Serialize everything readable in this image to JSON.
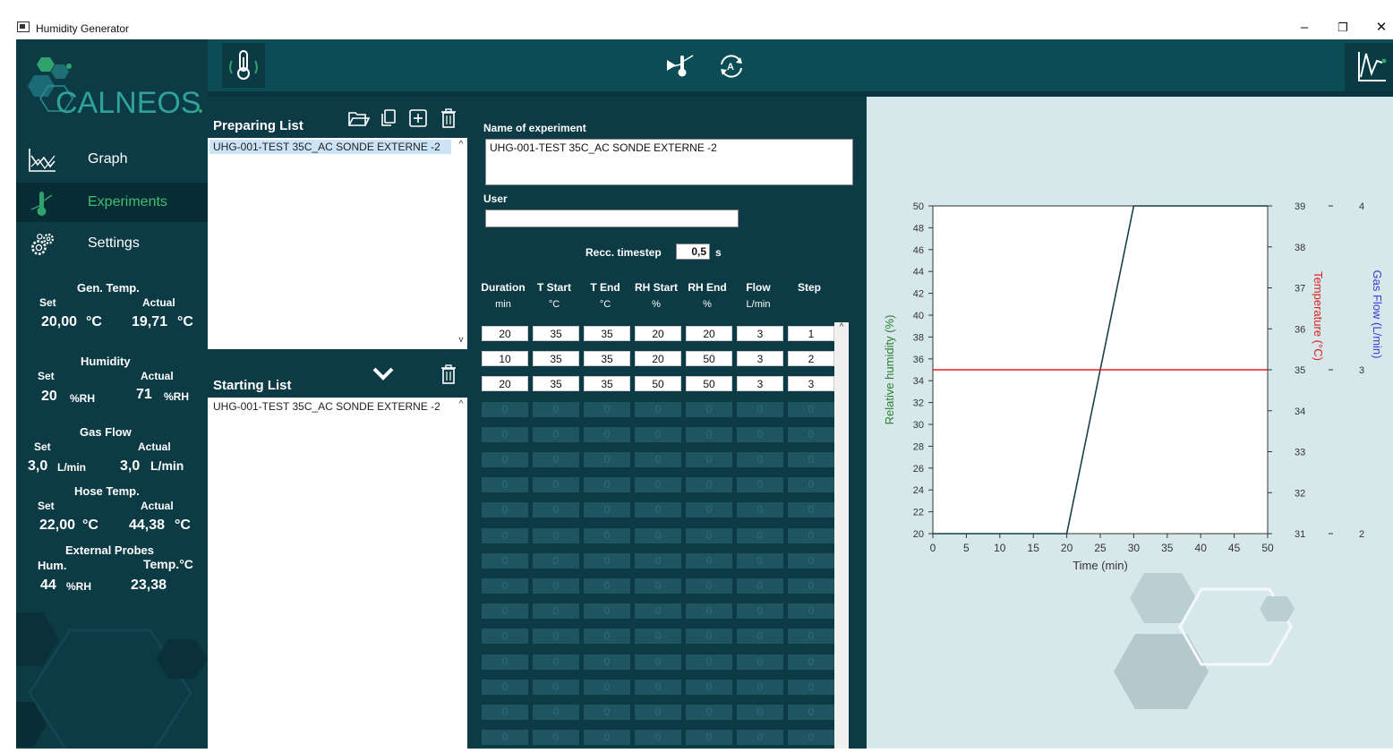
{
  "window": {
    "title": "Humidity Generator",
    "minimize": "–",
    "restore": "❐",
    "close": "✕"
  },
  "brand": {
    "logo_text": "CALNEOS"
  },
  "nav": [
    {
      "label": "Graph",
      "icon": "graph-icon"
    },
    {
      "label": "Experiments",
      "icon": "thermometer-icon",
      "active": true
    },
    {
      "label": "Settings",
      "icon": "gears-icon"
    }
  ],
  "stats": {
    "gen_temp": {
      "title": "Gen. Temp.",
      "set_label": "Set",
      "actual_label": "Actual",
      "set": "20,00",
      "set_unit": "°C",
      "actual": "19,71",
      "actual_unit": "°C"
    },
    "humidity": {
      "title": "Humidity",
      "set_label": "Set",
      "actual_label": "Actual",
      "set": "20",
      "set_unit": "%RH",
      "actual": "71",
      "actual_unit": "%RH"
    },
    "gas_flow": {
      "title": "Gas Flow",
      "set_label": "Set",
      "actual_label": "Actual",
      "set": "3,0",
      "set_unit": "L/min",
      "actual": "3,0",
      "actual_unit": "L/min"
    },
    "hose_temp": {
      "title": "Hose Temp.",
      "set_label": "Set",
      "actual_label": "Actual",
      "set": "22,00",
      "set_unit": "°C",
      "actual": "44,38",
      "actual_unit": "°C"
    },
    "ext_probes": {
      "title": "External Probes",
      "hum_label": "Hum.",
      "temp_label": "Temp.°C",
      "hum": "44",
      "hum_unit": "%RH",
      "temp": "23,38"
    }
  },
  "preparing_list": {
    "title": "Preparing  List",
    "items": [
      "UHG-001-TEST 35C_AC SONDE EXTERNE -2"
    ]
  },
  "starting_list": {
    "title": "Starting List",
    "items": [
      "UHG-001-TEST 35C_AC SONDE EXTERNE -2"
    ]
  },
  "experiment": {
    "name_label": "Name of experiment",
    "name_value": "UHG-001-TEST 35C_AC SONDE EXTERNE -2",
    "user_label": "User",
    "user_value": "",
    "timestep_label": "Recc. timestep",
    "timestep_value": "0,5",
    "timestep_unit": "s"
  },
  "table": {
    "columns": [
      {
        "label": "Duration",
        "unit": "min"
      },
      {
        "label": "T Start",
        "unit": "°C"
      },
      {
        "label": "T End",
        "unit": "°C"
      },
      {
        "label": "RH Start",
        "unit": "%"
      },
      {
        "label": "RH End",
        "unit": "%"
      },
      {
        "label": "Flow",
        "unit": "L/min"
      },
      {
        "label": "Step",
        "unit": ""
      }
    ],
    "rows": [
      [
        "20",
        "35",
        "35",
        "20",
        "20",
        "3",
        "1"
      ],
      [
        "10",
        "35",
        "35",
        "20",
        "50",
        "3",
        "2"
      ],
      [
        "20",
        "35",
        "35",
        "50",
        "50",
        "3",
        "3"
      ]
    ],
    "empty_value": "0",
    "empty_rows": 14
  },
  "chart_data": {
    "type": "line",
    "xlabel": "Time (min)",
    "ylabel": "Relative humidity (%)",
    "y2label": "Temperature (°C)",
    "y3label": "Gas Flow (L/min)",
    "xlim": [
      0,
      50
    ],
    "ylim": [
      20,
      50
    ],
    "y2lim": [
      31,
      39
    ],
    "y3lim": [
      2,
      4
    ],
    "x_ticks": [
      0,
      5,
      10,
      15,
      20,
      25,
      30,
      35,
      40,
      45,
      50
    ],
    "y_ticks": [
      20,
      22,
      24,
      26,
      28,
      30,
      32,
      34,
      36,
      38,
      40,
      42,
      44,
      46,
      48,
      50
    ],
    "y2_ticks": [
      31,
      32,
      33,
      34,
      35,
      36,
      37,
      38,
      39
    ],
    "y3_ticks": [
      2,
      3,
      4
    ],
    "series": [
      {
        "name": "Relative humidity (%)",
        "axis": "y",
        "color": "#17404a",
        "x": [
          0,
          20,
          30,
          50
        ],
        "y": [
          20,
          20,
          50,
          50
        ]
      },
      {
        "name": "Temperature (°C)",
        "axis": "y2",
        "color": "#e02020",
        "x": [
          0,
          50
        ],
        "y": [
          35,
          35
        ]
      },
      {
        "name": "Gas Flow (L/min)",
        "axis": "y3",
        "color": "#3a3ad8",
        "x": [
          0,
          50
        ],
        "y": [
          3,
          3
        ]
      }
    ],
    "colors": {
      "ylabel": "#2e7d32",
      "y2label": "#e02020",
      "y3label": "#3a3ad8"
    }
  }
}
